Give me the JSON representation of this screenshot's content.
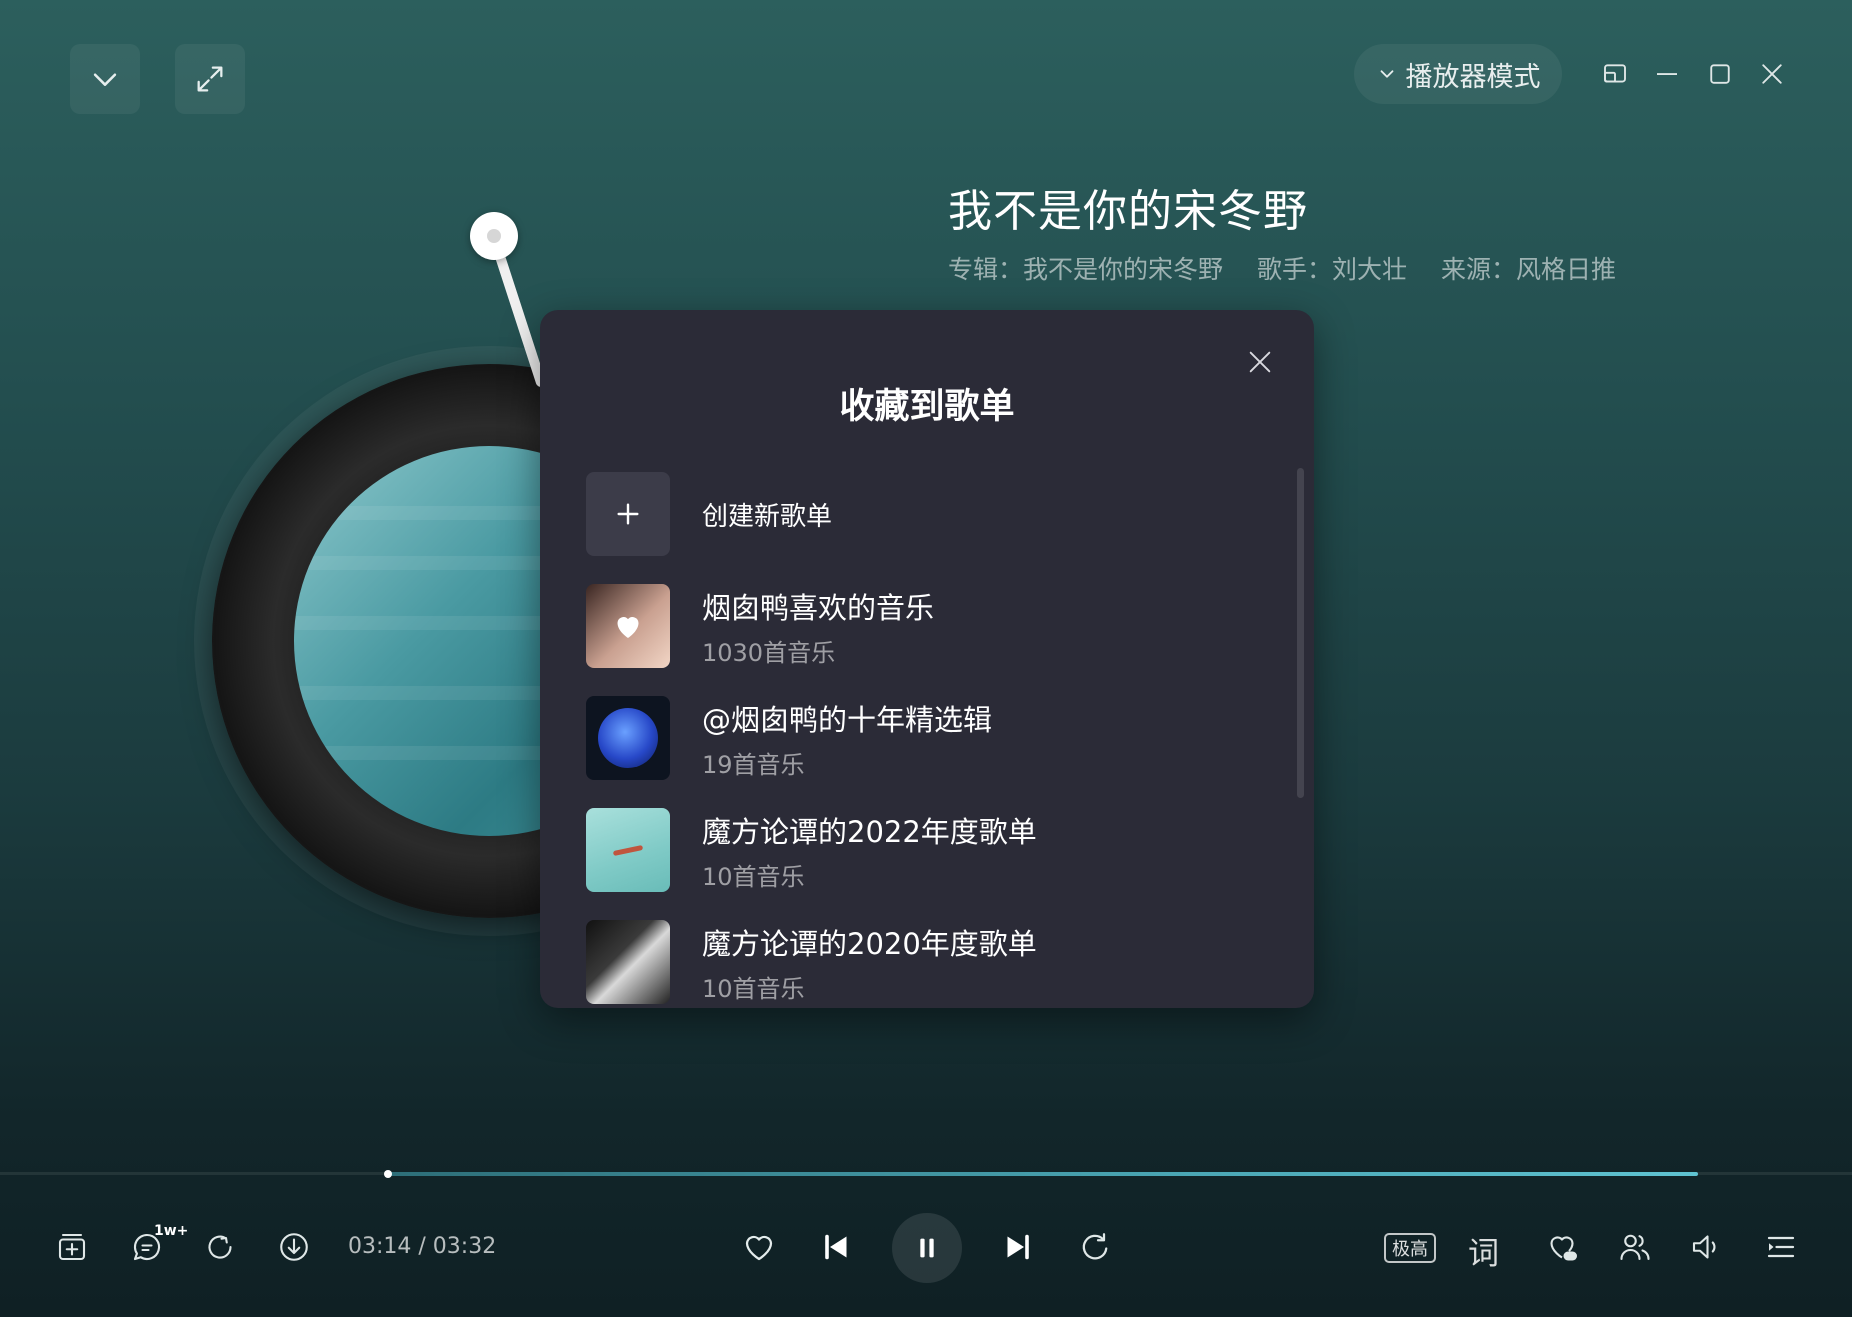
{
  "header": {
    "player_mode_label": "播放器模式"
  },
  "song": {
    "title": "我不是你的宋冬野",
    "album": "专辑：我不是你的宋冬野",
    "artist": "歌手：刘大壮",
    "source": "来源：风格日推"
  },
  "modal": {
    "title": "收藏到歌单",
    "create_label": "创建新歌单",
    "playlists": [
      {
        "name": "烟囱鸭喜欢的音乐",
        "count": "1030首音乐"
      },
      {
        "name": "@烟囱鸭的十年精选辑",
        "count": "19首音乐"
      },
      {
        "name": "魔方论谭的2022年度歌单",
        "count": "10首音乐"
      },
      {
        "name": "魔方论谭的2020年度歌单",
        "count": "10首音乐"
      }
    ]
  },
  "player": {
    "comment_badge": "1w+",
    "time_display": "03:14 / 03:32",
    "quality_label": "极高",
    "lyrics_label": "词",
    "progress": 0.915
  },
  "colors": {
    "accent": "#4aa6b4",
    "modal_bg": "#2b2b37"
  }
}
